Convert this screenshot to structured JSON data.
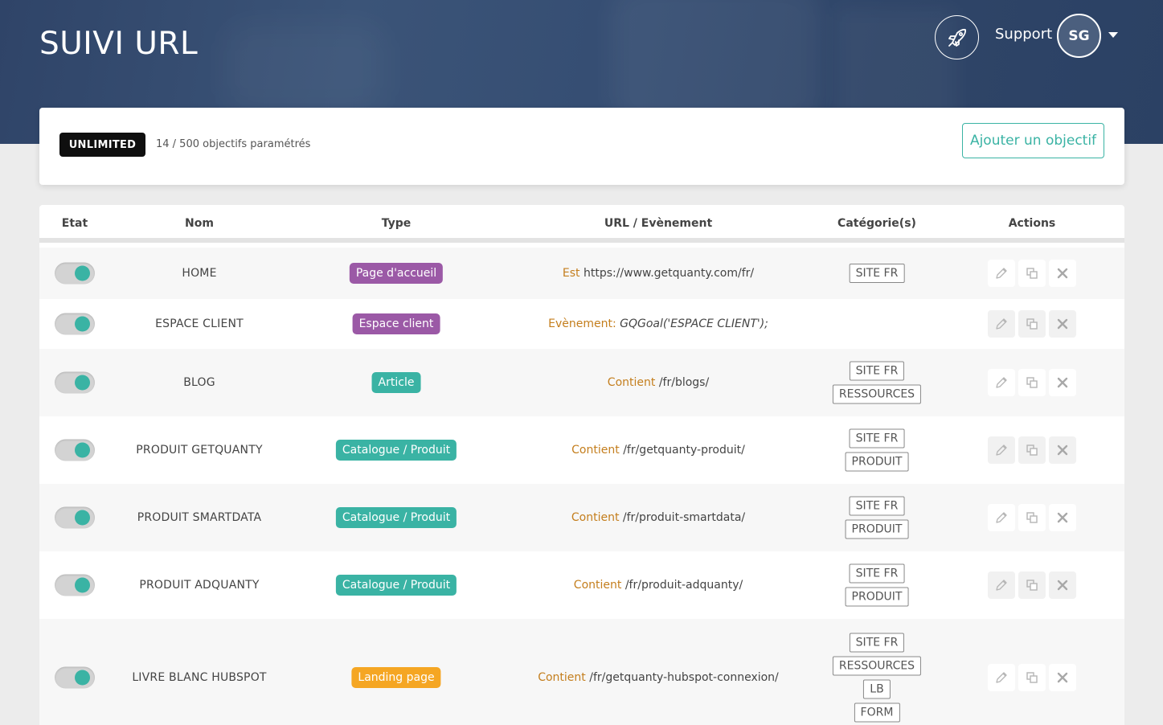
{
  "header": {
    "title": "SUIVI URL",
    "support_label": "Support",
    "avatar_initials": "SG"
  },
  "quota": {
    "plan": "UNLIMITED",
    "text": "14 / 500 objectifs paramétrés",
    "add_button": "Ajouter un objectif"
  },
  "table": {
    "columns": [
      "Etat",
      "Nom",
      "Type",
      "URL / Evènement",
      "Catégorie(s)",
      "Actions"
    ],
    "rows": [
      {
        "active": true,
        "name": "HOME",
        "type": "Page d'accueil",
        "type_color": "#9b59a6",
        "op": "Est",
        "value": "https://www.getquanty.com/fr/",
        "value_italic": false,
        "categories": [
          "SITE FR"
        ]
      },
      {
        "active": true,
        "name": "ESPACE CLIENT",
        "type": "Espace client",
        "type_color": "#9b59a6",
        "op": "Evènement:",
        "value": "GQGoal('ESPACE CLIENT');",
        "value_italic": true,
        "categories": []
      },
      {
        "active": true,
        "name": "BLOG",
        "type": "Article",
        "type_color": "#3ab3a4",
        "op": "Contient",
        "value": "/fr/blogs/",
        "value_italic": false,
        "categories": [
          "SITE FR",
          "RESSOURCES"
        ]
      },
      {
        "active": true,
        "name": "PRODUIT GETQUANTY",
        "type": "Catalogue / Produit",
        "type_color": "#3ab3a4",
        "op": "Contient",
        "value": "/fr/getquanty-produit/",
        "value_italic": false,
        "categories": [
          "SITE FR",
          "PRODUIT"
        ]
      },
      {
        "active": true,
        "name": "PRODUIT SMARTDATA",
        "type": "Catalogue / Produit",
        "type_color": "#3ab3a4",
        "op": "Contient",
        "value": "/fr/produit-smartdata/",
        "value_italic": false,
        "categories": [
          "SITE FR",
          "PRODUIT"
        ]
      },
      {
        "active": true,
        "name": "PRODUIT ADQUANTY",
        "type": "Catalogue / Produit",
        "type_color": "#3ab3a4",
        "op": "Contient",
        "value": "/fr/produit-adquanty/",
        "value_italic": false,
        "categories": [
          "SITE FR",
          "PRODUIT"
        ]
      },
      {
        "active": true,
        "name": "LIVRE BLANC HUBSPOT",
        "type": "Landing page",
        "type_color": "#f5a623",
        "op": "Contient",
        "value": "/fr/getquanty-hubspot-connexion/",
        "value_italic": false,
        "categories": [
          "SITE FR",
          "RESSOURCES",
          "LB",
          "FORM"
        ]
      }
    ]
  },
  "icons": {
    "rocket": "rocket-icon",
    "caret": "caret-down-icon",
    "edit": "pencil-icon",
    "duplicate": "duplicate-icon",
    "delete": "close-icon"
  },
  "colors": {
    "accent": "#3ab3a4",
    "purple": "#9b59a6",
    "orange": "#f5a623",
    "operator": "#c47e1d"
  }
}
